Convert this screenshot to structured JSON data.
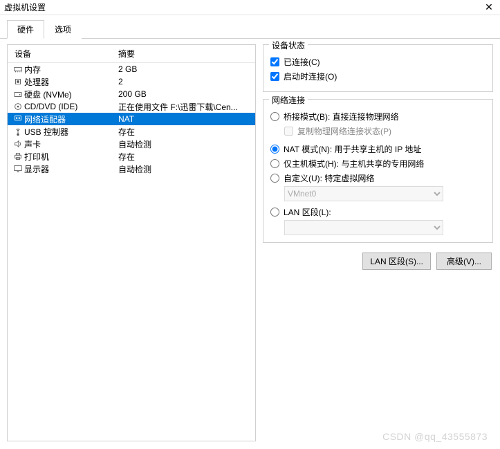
{
  "window": {
    "title": "虚拟机设置"
  },
  "tabs": {
    "hardware": "硬件",
    "options": "选项"
  },
  "hw_table": {
    "col_device": "设备",
    "col_summary": "摘要",
    "rows": [
      {
        "name": "内存",
        "summary": "2 GB"
      },
      {
        "name": "处理器",
        "summary": "2"
      },
      {
        "name": "硬盘 (NVMe)",
        "summary": "200 GB"
      },
      {
        "name": "CD/DVD (IDE)",
        "summary": "正在使用文件 F:\\迅雷下载\\Cen..."
      },
      {
        "name": "网络适配器",
        "summary": "NAT"
      },
      {
        "name": "USB 控制器",
        "summary": "存在"
      },
      {
        "name": "声卡",
        "summary": "自动检测"
      },
      {
        "name": "打印机",
        "summary": "存在"
      },
      {
        "name": "显示器",
        "summary": "自动检测"
      }
    ]
  },
  "device_status": {
    "legend": "设备状态",
    "connected": "已连接(C)",
    "connect_at_power": "启动时连接(O)"
  },
  "net": {
    "legend": "网络连接",
    "bridged": "桥接模式(B): 直接连接物理网络",
    "replicate": "复制物理网络连接状态(P)",
    "nat": "NAT 模式(N): 用于共享主机的 IP 地址",
    "hostonly": "仅主机模式(H): 与主机共享的专用网络",
    "custom": "自定义(U): 特定虚拟网络",
    "custom_value": "VMnet0",
    "lan": "LAN 区段(L):",
    "lan_value": ""
  },
  "buttons": {
    "lan_seg": "LAN 区段(S)...",
    "advanced": "高级(V)..."
  },
  "watermark": "CSDN @qq_43555873"
}
